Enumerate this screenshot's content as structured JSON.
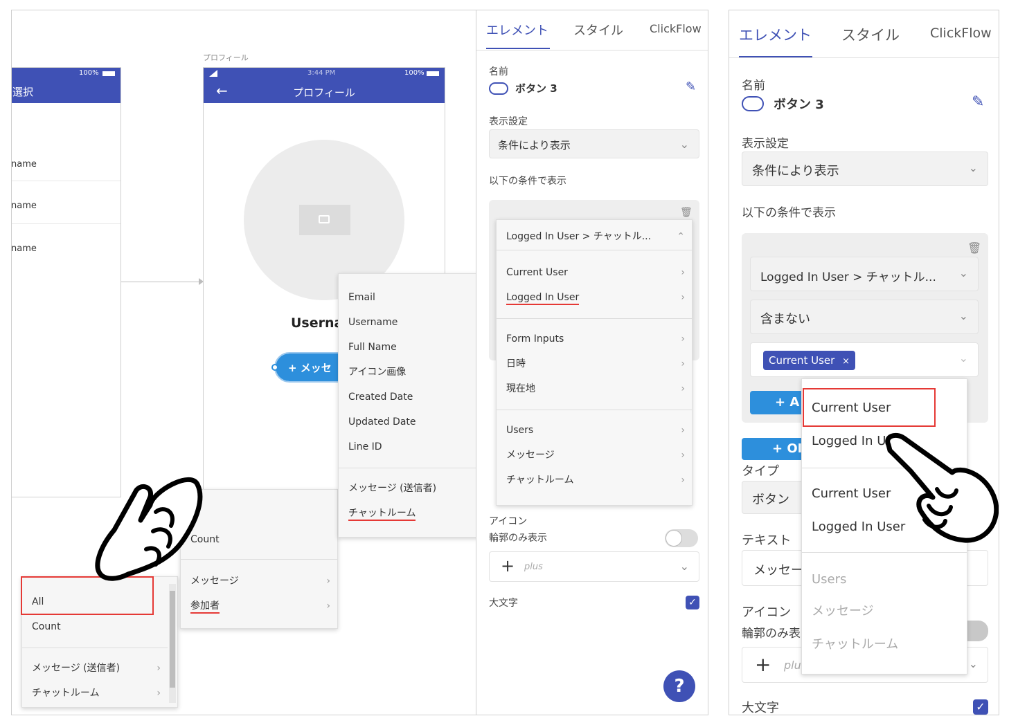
{
  "colors": {
    "accent": "#3f51b5",
    "underline": "#e53935",
    "button": "#2d8fdc"
  },
  "phone_left": {
    "status_battery": "100%",
    "title": "選択",
    "rows": [
      "name",
      "name",
      "name"
    ]
  },
  "phone_main": {
    "screen_label": "プロフィール",
    "status_time": "3:44 PM",
    "status_battery": "100%",
    "title": "プロフィール",
    "username": "Userna",
    "button_label": "+ メッセ"
  },
  "menu_bottom_left": {
    "items": [
      "All",
      "Count",
      "メッセージ (送信者)",
      "チャットルーム"
    ]
  },
  "menu_mid": {
    "items": [
      "Count",
      "メッセージ",
      "参加者"
    ]
  },
  "menu_fields": {
    "items": [
      "Email",
      "Username",
      "Full Name",
      "アイコン画像",
      "Created Date",
      "Updated Date",
      "Line ID",
      "メッセージ (送信者)",
      "チャットルーム"
    ]
  },
  "menu_sources": {
    "header": "Logged In User > チャットル...",
    "items": [
      "Current User",
      "Logged In User",
      "Form Inputs",
      "日時",
      "現在地",
      "Users",
      "メッセージ",
      "チャットルーム"
    ]
  },
  "panel1": {
    "tabs": [
      "エレメント",
      "スタイル",
      "ClickFlow"
    ],
    "name_label": "名前",
    "name_value": "ボタン 3",
    "visibility_label": "表示設定",
    "visibility_value": "条件により表示",
    "condition_label": "以下の条件で表示",
    "icon_label": "アイコン",
    "outline_label": "輪郭のみ表示",
    "icon_placeholder": "plus",
    "uppercase_label": "大文字",
    "help": "?"
  },
  "panel2": {
    "tabs": [
      "エレメント",
      "スタイル",
      "ClickFlow"
    ],
    "name_label": "名前",
    "name_value": "ボタン 3",
    "visibility_label": "表示設定",
    "visibility_value": "条件により表示",
    "condition_label": "以下の条件で表示",
    "cond_field": "Logged In User > チャットル...",
    "cond_operator": "含まない",
    "chip": "Current User",
    "add_btn": "+ A",
    "or_btn": "+ OI",
    "type_label": "タイプ",
    "type_value": "ボタン",
    "text_label": "テキスト",
    "text_value": "メッセー",
    "icon_label": "アイコン",
    "outline_label": "輪郭のみ表",
    "icon_placeholder": "plu",
    "uppercase_label": "大文字"
  },
  "menu_panel2": {
    "items": [
      "Current User",
      "Logged In Us",
      "Current User",
      "Logged In User",
      "Users",
      "メッセージ",
      "チャットルーム"
    ]
  }
}
